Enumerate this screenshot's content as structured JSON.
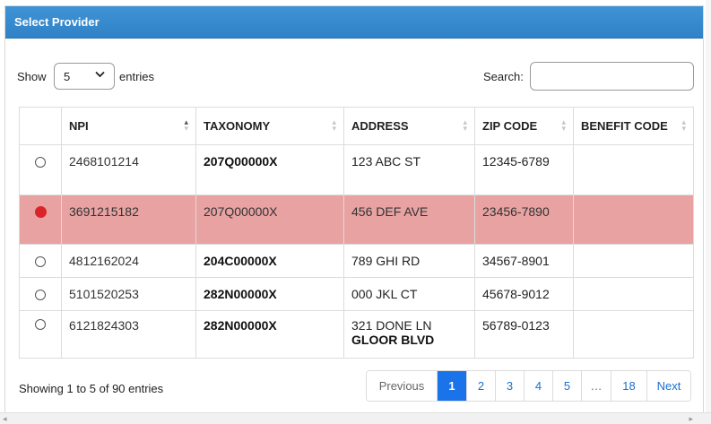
{
  "panel": {
    "title": "Select Provider"
  },
  "controls": {
    "show_label": "Show",
    "page_size": "5",
    "entries_label": "entries",
    "search_label": "Search:",
    "search_value": ""
  },
  "table": {
    "columns": [
      "",
      "NPI",
      "TAXONOMY",
      "ADDRESS",
      "ZIP CODE",
      "BENEFIT CODE"
    ],
    "rows": [
      {
        "selected": false,
        "npi": "2468101214",
        "taxonomy": "207Q00000X",
        "address_line1": "123 ABC ST",
        "address_line2": "",
        "zip": "12345-6789",
        "benefit": ""
      },
      {
        "selected": true,
        "npi": "3691215182",
        "taxonomy": "207Q00000X",
        "address_line1": "456 DEF AVE",
        "address_line2": "",
        "zip": "23456-7890",
        "benefit": ""
      },
      {
        "selected": false,
        "npi": "4812162024",
        "taxonomy": "204C00000X",
        "address_line1": "789 GHI RD",
        "address_line2": "",
        "zip": "34567-8901",
        "benefit": ""
      },
      {
        "selected": false,
        "npi": "5101520253",
        "taxonomy": "282N00000X",
        "address_line1": "000 JKL CT",
        "address_line2": "",
        "zip": "45678-9012",
        "benefit": ""
      },
      {
        "selected": false,
        "npi": "6121824303",
        "taxonomy": "282N00000X",
        "address_line1": "321 DONE LN",
        "address_line2": "GLOOR BLVD",
        "zip": "56789-0123",
        "benefit": ""
      }
    ]
  },
  "footer": {
    "info": "Showing 1 to 5 of 90 entries",
    "pagination": {
      "previous": "Previous",
      "pages": [
        "1",
        "2",
        "3",
        "4",
        "5"
      ],
      "ellipsis": "…",
      "last": "18",
      "next": "Next",
      "current": "1"
    }
  },
  "colors": {
    "header_blue": "#3189cf",
    "selected_row": "#e8a2a2",
    "radio_selected": "#d9242a",
    "active_page": "#1a73e8",
    "link": "#1a6fd0"
  },
  "icons": {
    "select_chevron": "chevron-down-icon",
    "sort": "sort-icon"
  }
}
